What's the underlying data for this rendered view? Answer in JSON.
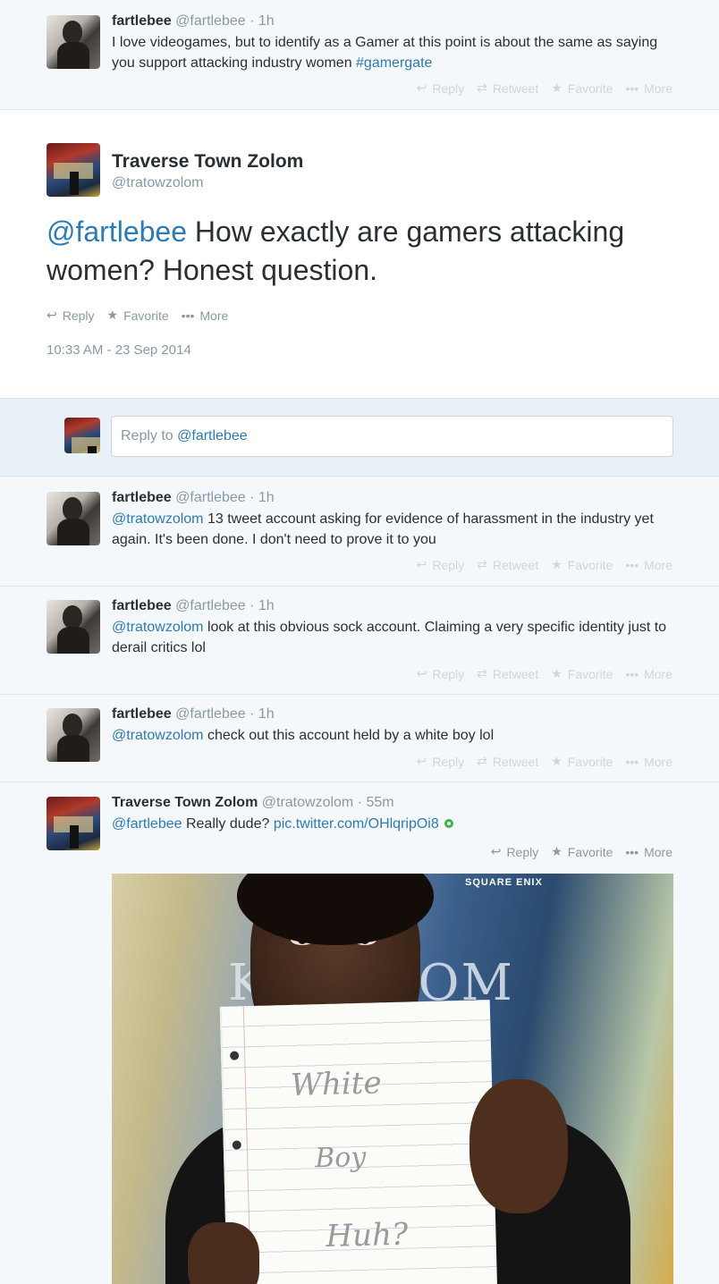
{
  "actions": {
    "reply": "Reply",
    "retweet": "Retweet",
    "favorite": "Favorite",
    "more": "More"
  },
  "icons": {
    "reply": "reply-arrow-icon",
    "retweet": "retweet-icon",
    "favorite": "star-icon",
    "more": "ellipsis-icon"
  },
  "colors": {
    "link": "#2b7bb9",
    "muted": "#8899a6",
    "faint_action": "#ccd6dd",
    "background": "#f5f8fa",
    "reply_band": "#e8f1f7"
  },
  "tweets": {
    "top": {
      "name": "fartlebee",
      "handle": "@fartlebee",
      "sep": "·",
      "time": "1h",
      "text": "I love videogames, but to identify as a Gamer at this point is about the same as saying you support attacking industry women ",
      "hashtag": "#gamergate"
    },
    "focus": {
      "name": "Traverse Town Zolom",
      "handle": "@tratowzolom",
      "mention": "@fartlebee",
      "text": " How exactly are gamers attacking women? Honest question.",
      "timestamp": "10:33 AM - 23 Sep 2014"
    },
    "reply_box": {
      "prefix": "Reply to ",
      "mention": "@fartlebee"
    },
    "r1": {
      "name": "fartlebee",
      "handle": "@fartlebee",
      "sep": "·",
      "time": "1h",
      "mention": "@tratowzolom",
      "text": " 13 tweet account asking for evidence of harassment in the industry yet again. It's been done. I don't need to prove it to you"
    },
    "r2": {
      "name": "fartlebee",
      "handle": "@fartlebee",
      "sep": "·",
      "time": "1h",
      "mention": "@tratowzolom",
      "text": " look at this obvious sock account. Claiming a very specific identity just to derail critics lol"
    },
    "r3": {
      "name": "fartlebee",
      "handle": "@fartlebee",
      "sep": "·",
      "time": "1h",
      "mention": "@tratowzolom",
      "text": " check out this account held by a white boy lol"
    },
    "r4": {
      "name": "Traverse Town Zolom",
      "handle": "@tratowzolom",
      "sep": "·",
      "time": "55m",
      "mention": "@fartlebee",
      "text": " Really dude? ",
      "link": "pic.twitter.com/OHlqripOi8"
    }
  },
  "photo": {
    "logo": "SQUARE ENIX",
    "poster_text": "KINGDOM HEARTS",
    "note_line1": "White",
    "note_line2": "Boy",
    "note_line3": "Huh?"
  }
}
